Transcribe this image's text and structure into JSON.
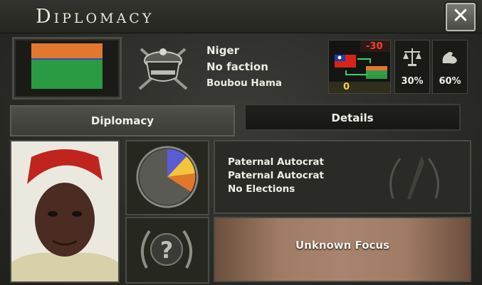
{
  "window": {
    "title": "Diplomacy",
    "close_label": "✕"
  },
  "country": {
    "name": "Niger",
    "faction": "No faction",
    "leader": "Boubou Hama",
    "flag_colors": [
      "#e2782f",
      "#2a9a43",
      "#3b47b5"
    ]
  },
  "relations": {
    "opinion": "-30",
    "tension": "0"
  },
  "stats": [
    {
      "icon": "scales-icon",
      "value": "30%"
    },
    {
      "icon": "strength-arm-icon",
      "value": "60%"
    }
  ],
  "tabs": [
    {
      "label": "Diplomacy",
      "active": true
    },
    {
      "label": "Details",
      "active": false
    }
  ],
  "government": {
    "lines": [
      "Paternal Autocrat",
      "Paternal Autocrat",
      "No Elections"
    ]
  },
  "focus": {
    "label": "Unknown Focus"
  },
  "unknown_icon": "?"
}
